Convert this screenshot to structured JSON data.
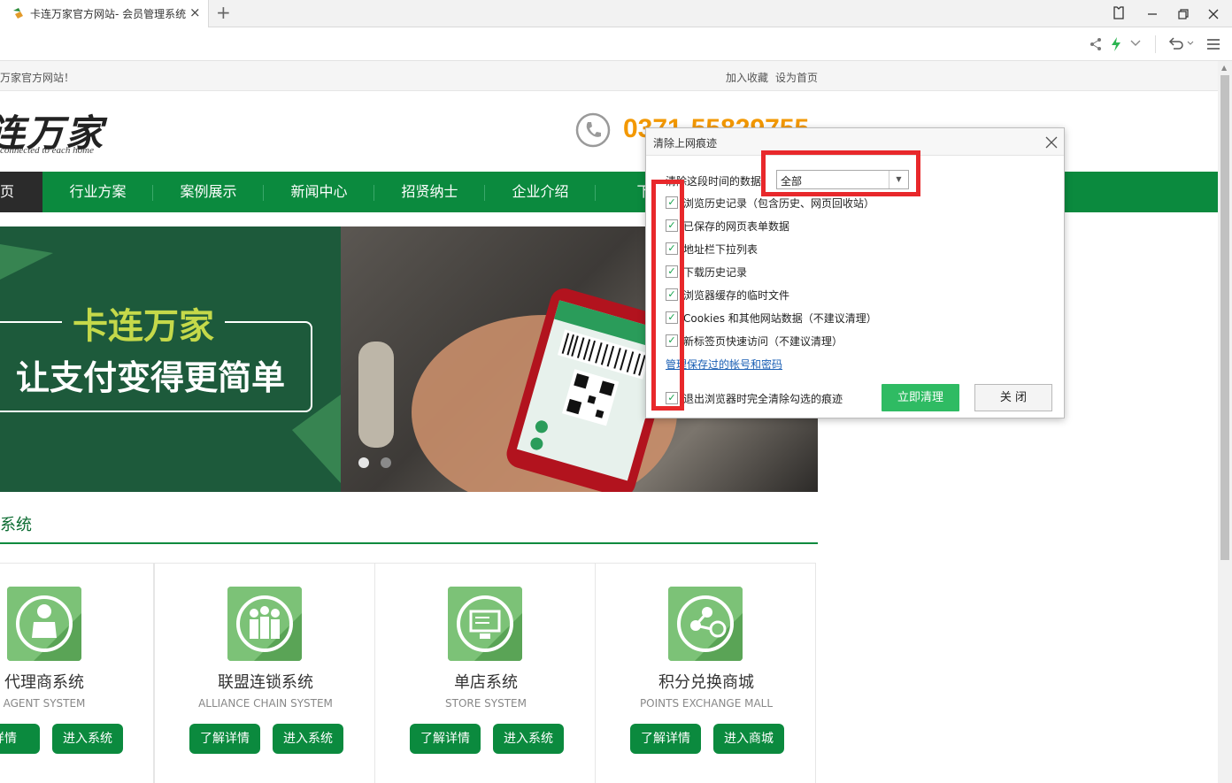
{
  "browser": {
    "tab_title": "卡连万家官方网站- 会员管理系统",
    "tab_close": "×",
    "new_tab": "+",
    "window_buttons": [
      "shirt-icon",
      "minimize-icon",
      "restore-icon",
      "close-icon"
    ]
  },
  "topbar": {
    "welcome": "万家官方网站！",
    "add_favorite": "加入收藏",
    "set_homepage": "设为首页"
  },
  "header": {
    "logo": "连万家",
    "logo_sub": "connected to each home",
    "phone": "0371-55829755"
  },
  "nav": {
    "home": "页",
    "items": [
      "行业方案",
      "案例展示",
      "新闻中心",
      "招贤纳士",
      "企业介绍",
      "下载"
    ]
  },
  "banner": {
    "title": "卡连万家",
    "slogan": "让支付变得更简单"
  },
  "section": {
    "title": "系统"
  },
  "cards": [
    {
      "title": "代理商系统",
      "subtitle": "AGENT SYSTEM",
      "btn1": "详情",
      "btn2": "进入系统"
    },
    {
      "title": "联盟连锁系统",
      "subtitle": "ALLIANCE CHAIN SYSTEM",
      "btn1": "了解详情",
      "btn2": "进入系统"
    },
    {
      "title": "单店系统",
      "subtitle": "STORE SYSTEM",
      "btn1": "了解详情",
      "btn2": "进入系统"
    },
    {
      "title": "积分兑换商城",
      "subtitle": "POINTS EXCHANGE MALL",
      "btn1": "了解详情",
      "btn2": "进入商城"
    }
  ],
  "dialog": {
    "title": "清除上网痕迹",
    "range_label": "清除这段时间的数据",
    "range_value": "全部",
    "options": [
      {
        "label": "浏览历史记录（包含历史、网页回收站）",
        "checked": true
      },
      {
        "label": "已保存的网页表单数据",
        "checked": true
      },
      {
        "label": "地址栏下拉列表",
        "checked": true
      },
      {
        "label": "下载历史记录",
        "checked": true
      },
      {
        "label": "浏览器缓存的临时文件",
        "checked": true
      },
      {
        "label": "Cookies 和其他网站数据（不建议清理）",
        "checked": true
      },
      {
        "label": "新标签页快速访问（不建议清理）",
        "checked": true
      }
    ],
    "manage_link": "管理保存过的帐号和密码",
    "exit_clear": "退出浏览器时完全清除勾选的痕迹",
    "exit_checked": true,
    "clear_button": "立即清理",
    "close_button": "关 闭"
  },
  "colors": {
    "brand_green": "#0b8a3e",
    "phone_orange": "#f39800",
    "highlight_red": "#e8282b",
    "clear_green": "#2fbb63"
  }
}
